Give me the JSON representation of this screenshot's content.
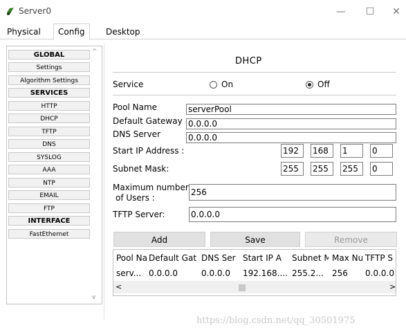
{
  "window": {
    "title": "Server0",
    "minimize": "—",
    "maximize": "☐",
    "close": "✕"
  },
  "tabs": [
    "Physical",
    "Config",
    "Desktop"
  ],
  "sidebar": {
    "items": [
      "GLOBAL",
      "Settings",
      "Algorithm Settings",
      "SERVICES",
      "HTTP",
      "DHCP",
      "TFTP",
      "DNS",
      "SYSLOG",
      "AAA",
      "NTP",
      "EMAIL",
      "FTP",
      "INTERFACE",
      "FastEthernet"
    ],
    "scroll_up": "^",
    "scroll_down": "v"
  },
  "dhcp": {
    "heading": "DHCP",
    "service_label": "Service",
    "on_label": "On",
    "off_label": "Off",
    "service_value": "Off",
    "pool_name_label": "Pool Name",
    "pool_name": "serverPool",
    "default_gateway_label": "Default Gateway",
    "default_gateway": "0.0.0.0",
    "dns_server_label": "DNS Server",
    "dns_server": "0.0.0.0",
    "start_ip_label": "Start IP Address :",
    "start_ip": [
      "192",
      "168",
      "1",
      "0"
    ],
    "subnet_mask_label": "Subnet Mask:",
    "subnet_mask": [
      "255",
      "255",
      "255",
      "0"
    ],
    "max_users_label_1": "Maximum number",
    "max_users_label_2": "of Users :",
    "max_users": "256",
    "tftp_label": "TFTP Server:",
    "tftp_server": "0.0.0.0",
    "buttons": {
      "add": "Add",
      "save": "Save",
      "remove": "Remove"
    }
  },
  "table": {
    "headers": [
      "Pool Na",
      "Default Gat",
      "DNS Ser",
      "Start IP A",
      "Subnet M",
      "Max Nu",
      "TFTP S"
    ],
    "rows": [
      [
        "serv...",
        "0.0.0.0",
        "0.0.0.0",
        "192.168....",
        "255.2...",
        "256",
        "0.0.0.0"
      ]
    ],
    "scroll_left": "<",
    "scroll_right": ">"
  },
  "watermark": "https://blog.csdn.net/qq_30501975"
}
